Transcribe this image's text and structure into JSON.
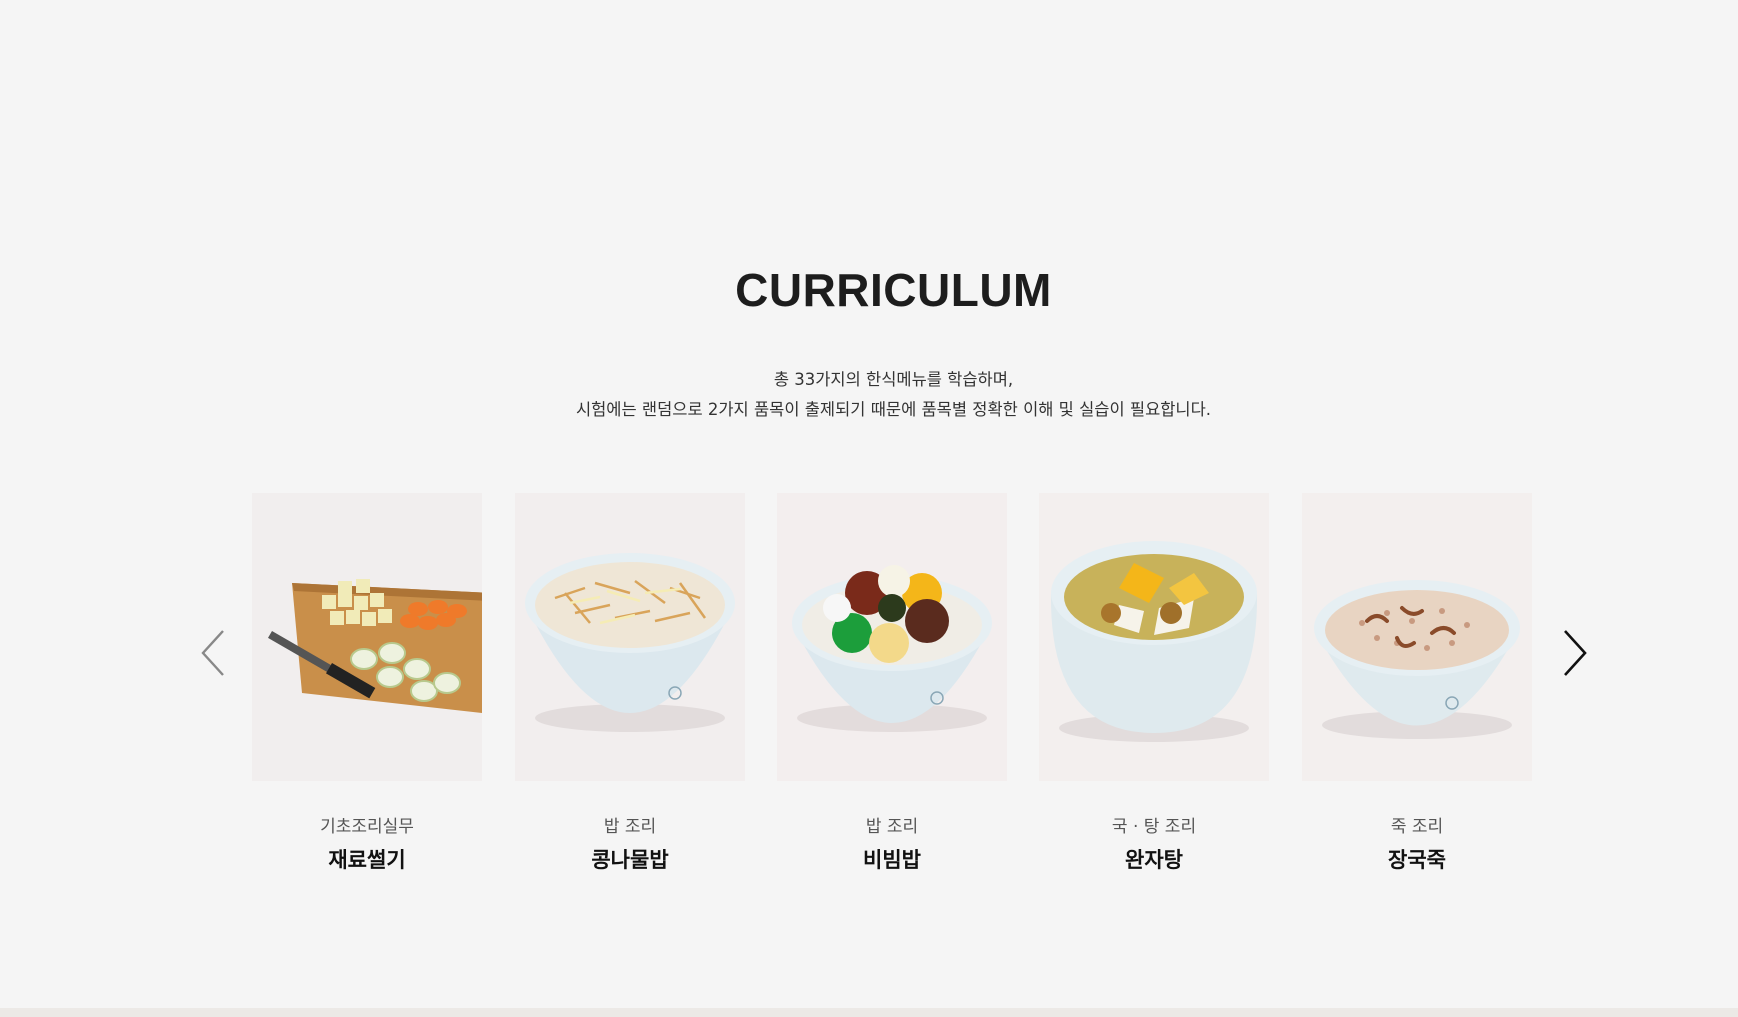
{
  "section": {
    "title": "CURRICULUM",
    "description_line1": "총 33가지의 한식메뉴를 학습하며,",
    "description_line2": "시험에는 랜덤으로 2가지 품목이 출제되기 때문에 품목별 정확한 이해 및 실습이 필요합니다."
  },
  "carousel": {
    "prev_icon": "chevron-left-icon",
    "next_icon": "chevron-right-icon",
    "items": [
      {
        "category": "기초조리실무",
        "name": "재료썰기",
        "image": "cutting-board-vegetables"
      },
      {
        "category": "밥 조리",
        "name": "콩나물밥",
        "image": "bean-sprout-rice-bowl"
      },
      {
        "category": "밥 조리",
        "name": "비빔밥",
        "image": "bibimbap-bowl"
      },
      {
        "category": "국 · 탕 조리",
        "name": "완자탕",
        "image": "meatball-soup-bowl"
      },
      {
        "category": "죽 조리",
        "name": "장국죽",
        "image": "rice-porridge-bowl"
      }
    ]
  },
  "colors": {
    "background": "#f5f5f5",
    "title": "#1d1d1d",
    "bowl": "#dfe9ef"
  }
}
